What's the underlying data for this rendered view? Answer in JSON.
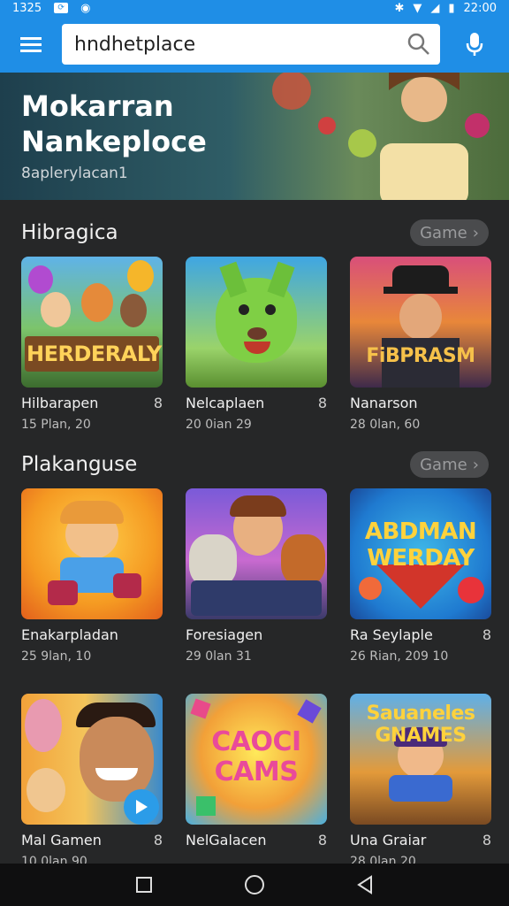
{
  "status": {
    "time_left": "1325",
    "time_right": "22:00"
  },
  "search": {
    "value": "hndhetplace"
  },
  "hero": {
    "title": "Mokarran Nankeploce",
    "subtitle": "8aplerylacan1"
  },
  "sections": [
    {
      "title": "Hibragica",
      "button": "Game",
      "cards": [
        {
          "banner": "HERDERALY",
          "title": "Hilbarapen",
          "rating": "8",
          "meta": "15 Plan, 20"
        },
        {
          "banner": "",
          "title": "Nelcaplaen",
          "rating": "8",
          "meta": "20 0ian 29"
        },
        {
          "banner": "FiBPRASM",
          "title": "Nanarson",
          "rating": "",
          "meta": "28 0lan, 60"
        }
      ]
    },
    {
      "title": "Plakanguse",
      "button": "Game",
      "cards": [
        {
          "banner": "",
          "title": "Enakarpladan",
          "rating": "",
          "meta": "25 9lan, 10"
        },
        {
          "banner": "",
          "title": "Foresiagen",
          "rating": "",
          "meta": "29 0lan 31"
        },
        {
          "banner": "ABDMAN WERDAY",
          "title": "Ra Seylaple",
          "rating": "8",
          "meta": "26 Rian, 209 10"
        },
        {
          "banner": "",
          "title": "Mal Gamen",
          "rating": "8",
          "meta": "10 0lan 90"
        },
        {
          "banner": "CAOCI CAMS",
          "title": "NelGalacen",
          "rating": "8",
          "meta": ""
        },
        {
          "banner": "Sauaneles GNAMES",
          "title": "Una Graiar",
          "rating": "8",
          "meta": "28 0lan 20"
        }
      ]
    }
  ],
  "colors": {
    "accent": "#1f8ee6",
    "background": "#262728",
    "navbar": "#0f0f10"
  }
}
